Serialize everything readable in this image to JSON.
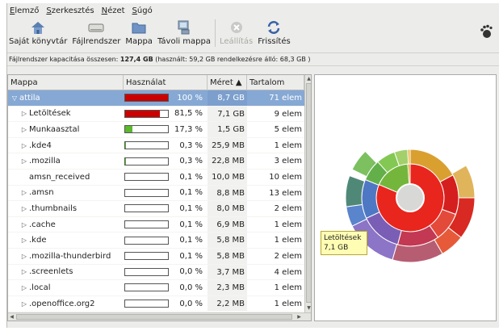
{
  "menubar": [
    {
      "accel": "E",
      "rest": "lemző"
    },
    {
      "accel": "S",
      "rest": "zerkesztés"
    },
    {
      "accel": "N",
      "rest": "ézet"
    },
    {
      "accel": "S",
      "rest": "úgó"
    }
  ],
  "toolbar": {
    "buttons": [
      {
        "label": "Saját könyvtár",
        "icon": "home-icon",
        "enabled": true
      },
      {
        "label": "Fájlrendszer",
        "icon": "drive-icon",
        "enabled": true
      },
      {
        "label": "Mappa",
        "icon": "folder-icon",
        "enabled": true
      },
      {
        "label": "Távoli mappa",
        "icon": "network-folder-icon",
        "enabled": true
      },
      {
        "label": "Leállítás",
        "icon": "stop-icon",
        "enabled": false
      },
      {
        "label": "Frissítés",
        "icon": "refresh-icon",
        "enabled": true
      }
    ]
  },
  "infobar": {
    "prefix": "Fájlrendszer kapacitása összesen: ",
    "total": "127,4 GB",
    "suffix": " (használt: 59,2 GB rendelkezésre álló: 68,3 GB )"
  },
  "table": {
    "headers": {
      "name": "Mappa",
      "usage": "Használat",
      "size": "Méret ▲",
      "count": "Tartalom"
    },
    "rows": [
      {
        "name": "attila",
        "pct": "100 %",
        "pct_value": 100,
        "size": "8,7 GB",
        "count": "71 elem",
        "expander": "▽",
        "selected": true,
        "color": "#cc0000"
      },
      {
        "name": "Letöltések",
        "pct": "81,5 %",
        "pct_value": 81.5,
        "size": "7,1 GB",
        "count": "9 elem",
        "expander": "▷",
        "selected": false,
        "color": "#cc0000"
      },
      {
        "name": "Munkaasztal",
        "pct": "17,3 %",
        "pct_value": 17.3,
        "size": "1,5 GB",
        "count": "5 elem",
        "expander": "▷",
        "selected": false,
        "color": "#5cb82e"
      },
      {
        "name": ".kde4",
        "pct": "0,3 %",
        "pct_value": 0.3,
        "size": "25,9 MB",
        "count": "1 elem",
        "expander": "▷",
        "selected": false,
        "color": "#5cb82e"
      },
      {
        "name": ".mozilla",
        "pct": "0,3 %",
        "pct_value": 0.3,
        "size": "22,8 MB",
        "count": "3 elem",
        "expander": "▷",
        "selected": false,
        "color": "#5cb82e"
      },
      {
        "name": "amsn_received",
        "pct": "0,1 %",
        "pct_value": 0.1,
        "size": "10,0 MB",
        "count": "10 elem",
        "expander": "",
        "selected": false,
        "color": "#5cb82e"
      },
      {
        "name": ".amsn",
        "pct": "0,1 %",
        "pct_value": 0.1,
        "size": "8,8 MB",
        "count": "13 elem",
        "expander": "▷",
        "selected": false,
        "color": "#5cb82e"
      },
      {
        "name": ".thumbnails",
        "pct": "0,1 %",
        "pct_value": 0.1,
        "size": "8,0 MB",
        "count": "2 elem",
        "expander": "▷",
        "selected": false,
        "color": "#5cb82e"
      },
      {
        "name": ".cache",
        "pct": "0,1 %",
        "pct_value": 0.1,
        "size": "6,9 MB",
        "count": "1 elem",
        "expander": "▷",
        "selected": false,
        "color": "#5cb82e"
      },
      {
        "name": ".kde",
        "pct": "0,1 %",
        "pct_value": 0.1,
        "size": "5,8 MB",
        "count": "1 elem",
        "expander": "▷",
        "selected": false,
        "color": "#5cb82e"
      },
      {
        "name": ".mozilla-thunderbird",
        "pct": "0,1 %",
        "pct_value": 0.1,
        "size": "5,8 MB",
        "count": "2 elem",
        "expander": "▷",
        "selected": false,
        "color": "#5cb82e"
      },
      {
        "name": ".screenlets",
        "pct": "0,0 %",
        "pct_value": 0.0,
        "size": "3,7 MB",
        "count": "4 elem",
        "expander": "▷",
        "selected": false,
        "color": "#5cb82e"
      },
      {
        "name": ".local",
        "pct": "0,0 %",
        "pct_value": 0.0,
        "size": "2,3 MB",
        "count": "1 elem",
        "expander": "▷",
        "selected": false,
        "color": "#5cb82e"
      },
      {
        "name": ".openoffice.org2",
        "pct": "0,0 %",
        "pct_value": 0.0,
        "size": "2,2 MB",
        "count": "1 elem",
        "expander": "▷",
        "selected": false,
        "color": "#5cb82e"
      }
    ]
  },
  "ring_chart": {
    "tooltip": {
      "name": "Letöltések",
      "size": "7,1 GB"
    },
    "rings": [
      {
        "segments": [
          {
            "start_deg": 0,
            "end_deg": 293,
            "color": "#e8261e"
          },
          {
            "start_deg": 293,
            "end_deg": 356,
            "color": "#74b63c"
          },
          {
            "start_deg": 356,
            "end_deg": 360,
            "color": "#d9a030"
          }
        ]
      },
      {
        "segments": [
          {
            "start_deg": 0,
            "end_deg": 62,
            "color": "#d9a030"
          },
          {
            "start_deg": 62,
            "end_deg": 110,
            "color": "#d51e1e"
          },
          {
            "start_deg": 110,
            "end_deg": 145,
            "color": "#e44a3a"
          },
          {
            "start_deg": 145,
            "end_deg": 195,
            "color": "#c33852"
          },
          {
            "start_deg": 195,
            "end_deg": 245,
            "color": "#7a5eb6"
          },
          {
            "start_deg": 245,
            "end_deg": 292,
            "color": "#4f78c4"
          },
          {
            "start_deg": 292,
            "end_deg": 318,
            "color": "#63b04a"
          },
          {
            "start_deg": 318,
            "end_deg": 341,
            "color": "#84c854"
          },
          {
            "start_deg": 341,
            "end_deg": 357,
            "color": "#a3d06a"
          },
          {
            "start_deg": 357,
            "end_deg": 360,
            "color": "#e9b64e"
          }
        ]
      },
      {
        "segments": [
          {
            "start_deg": 60,
            "end_deg": 90,
            "color": "#e0b45a"
          },
          {
            "start_deg": 90,
            "end_deg": 128,
            "color": "#d82a22"
          },
          {
            "start_deg": 128,
            "end_deg": 150,
            "color": "#e65a3a"
          },
          {
            "start_deg": 150,
            "end_deg": 196,
            "color": "#b75d72"
          },
          {
            "start_deg": 196,
            "end_deg": 244,
            "color": "#8c74c6"
          },
          {
            "start_deg": 244,
            "end_deg": 262,
            "color": "#5a84cc"
          },
          {
            "start_deg": 262,
            "end_deg": 290,
            "color": "#508878"
          },
          {
            "start_deg": 296,
            "end_deg": 316,
            "color": "#7cc060"
          }
        ]
      }
    ]
  }
}
